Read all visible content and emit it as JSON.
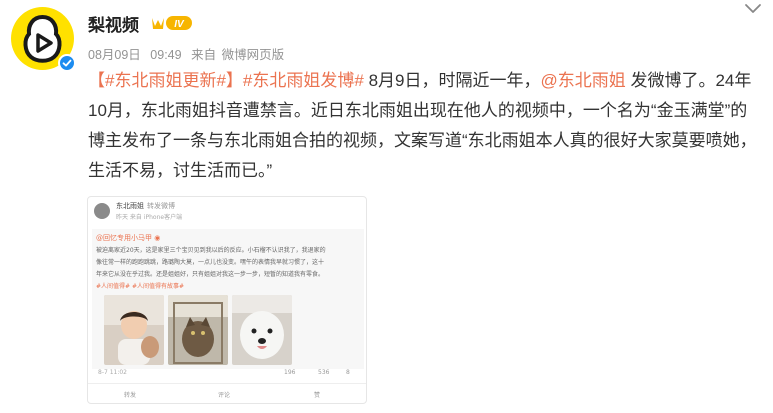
{
  "post": {
    "author": "梨视频",
    "vip_level": "IV",
    "date": "08月09日",
    "time": "09:49",
    "source_prefix": "来自",
    "source": "微博网页版"
  },
  "content": {
    "tag1": "【#东北雨姐更新#】",
    "tag2": "#东北雨姐发博#",
    "text1": " 8月9日，时隔近一年，",
    "mention": "@东北雨姐",
    "text2": " 发微博了。24年10月，东北雨姐抖音遭禁言。近日东北雨姐出现在他人的视频中，一个名为“金玉满堂”的博主发布了一条与东北雨姐合拍的视频，文案写道“东北雨姐本人真的很好大家莫要喷她，生活不易，讨生活而已。”"
  },
  "screenshot": {
    "name": "东北雨姐",
    "name_suffix": "转发微博",
    "sub": "昨天 来自 iPhone客户端",
    "handle": "@回忆专用小马甲 ◉",
    "lines": [
      "被迫离家近20天，这是家里三个宝贝见到我以后的反应。小石榴不认识我了，我退家的",
      "像往常一样的跑跑跳跳，路璐陶大莫，一点儿也没变。嘿午的表情我早就习惯了，这十",
      "年来它从没在乎过我。还是姐姐好，只有姐姐对我这一步一步，短暂的知道我有零食。"
    ],
    "tags": "#人间值得#  #人间值得有故事#",
    "date": "8-7 11:02",
    "forward_count": "196",
    "comment_count": "536",
    "like_count": "8",
    "footer_forward": "转发",
    "footer_comment": "评论",
    "footer_like": "赞"
  },
  "colors": {
    "link": "#EB7350",
    "meta": "#939393",
    "avatar_bg": "#FFE100",
    "verified": "#1D8CF0"
  }
}
